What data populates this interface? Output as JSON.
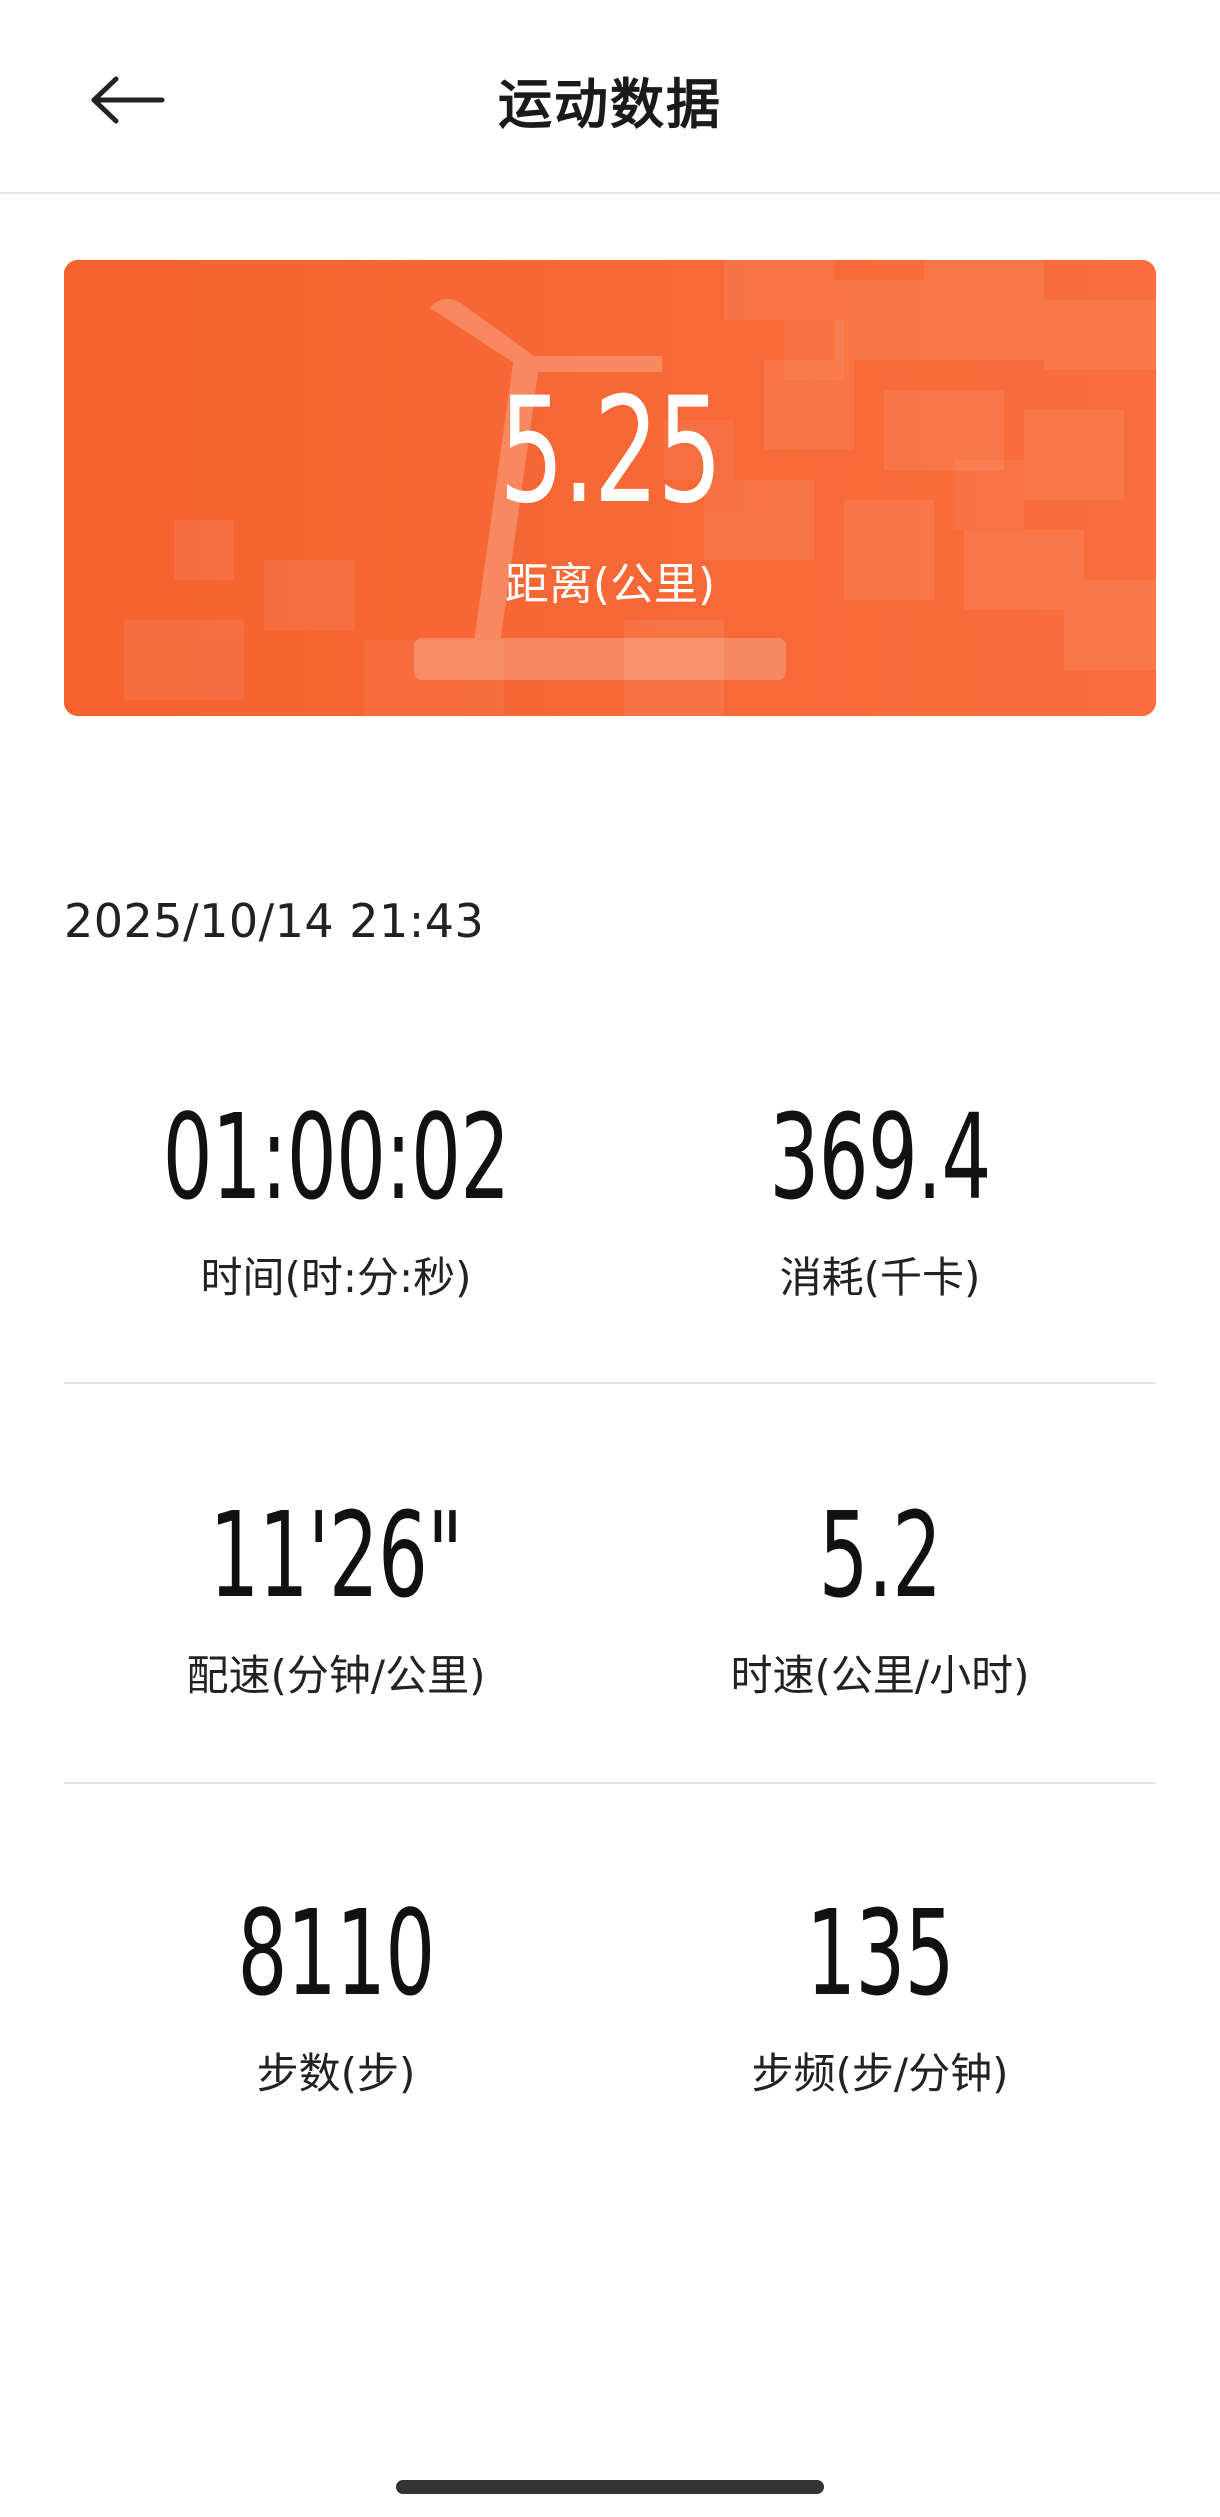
{
  "header": {
    "title": "运动数据"
  },
  "hero": {
    "value": "5.25",
    "label": "距离(公里)",
    "color": "#f76634"
  },
  "date": "2025/10/14 21:43",
  "stats": [
    {
      "value": "01:00:02",
      "label": "时间(时:分:秒)"
    },
    {
      "value": "369.4",
      "label": "消耗(千卡)"
    },
    {
      "value": "11'26\"",
      "label": "配速(分钟/公里)"
    },
    {
      "value": "5.2",
      "label": "时速(公里/小时)"
    },
    {
      "value": "8110",
      "label": "步数(步)"
    },
    {
      "value": "135",
      "label": "步频(步/分钟)"
    }
  ],
  "icons": {
    "back": "arrow-left-icon",
    "hero_background": "treadmill-icon"
  }
}
